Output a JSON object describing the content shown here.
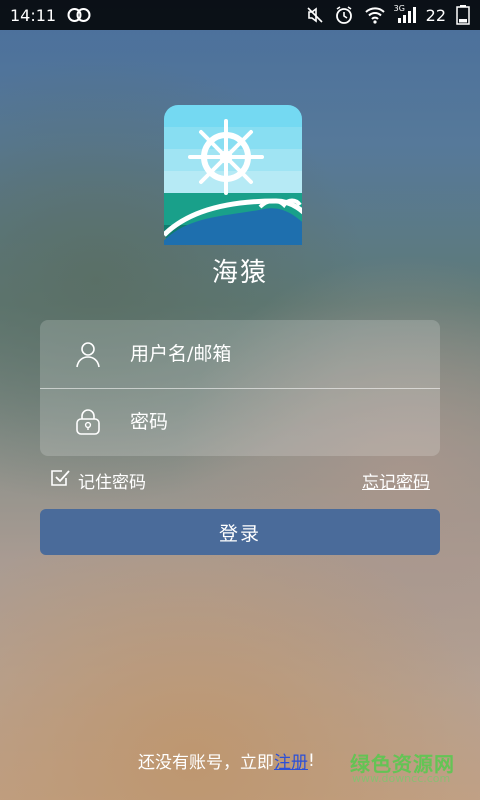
{
  "status_bar": {
    "time": "14:11",
    "network_label": "3G",
    "battery_level": "22"
  },
  "app": {
    "name": "海猿",
    "logo_icon": "ship-wheel-wave-logo"
  },
  "form": {
    "username_placeholder": "用户名/邮箱",
    "password_placeholder": "密码",
    "remember_label": "记住密码",
    "forgot_label": "忘记密码",
    "login_label": "登录"
  },
  "footer": {
    "no_account_text": "还没有账号，立即",
    "register_link": "注册",
    "exclamation": "!",
    "watermark": "绿色资源网",
    "watermark_sub": "www.downcc.com"
  },
  "colors": {
    "login_button": "#4a6b9a",
    "register_link": "#2b4fd8"
  }
}
